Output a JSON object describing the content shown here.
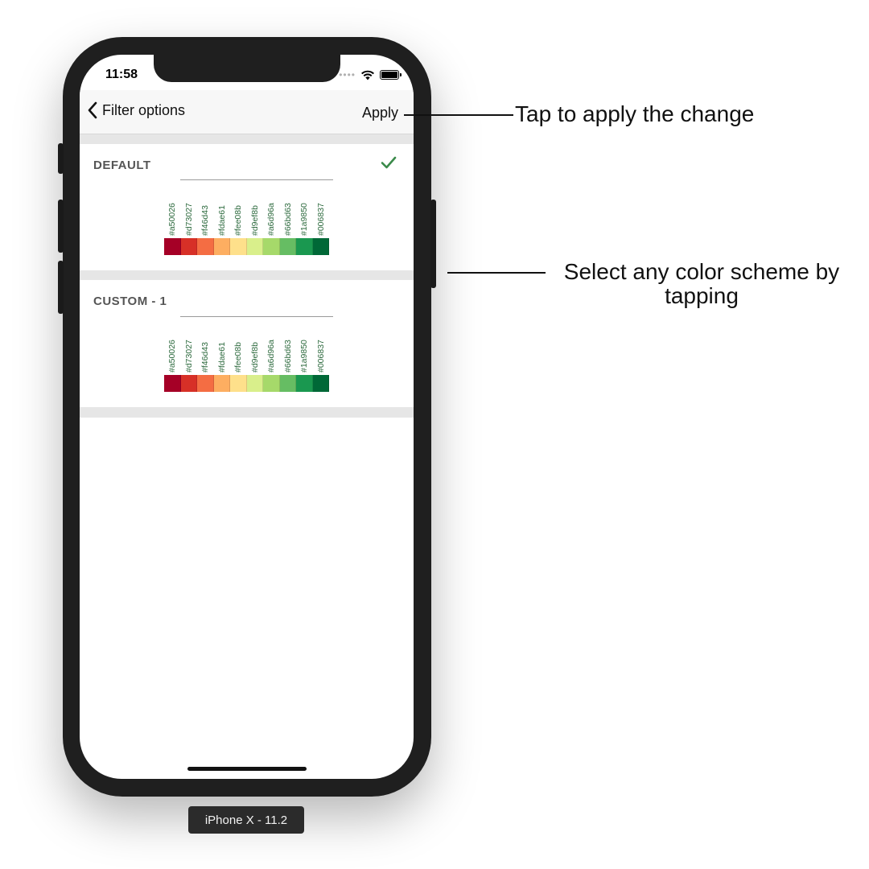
{
  "status_bar": {
    "time": "11:58",
    "signal_dots": "••••"
  },
  "navbar": {
    "back_label": "Filter options",
    "apply_label": "Apply"
  },
  "schemes": [
    {
      "title": "DEFAULT",
      "selected": true,
      "colors": [
        "#a50026",
        "#d73027",
        "#f46d43",
        "#fdae61",
        "#fee08b",
        "#d9ef8b",
        "#a6d96a",
        "#66bd63",
        "#1a9850",
        "#006837"
      ]
    },
    {
      "title": "CUSTOM - 1",
      "selected": false,
      "colors": [
        "#a50026",
        "#d73027",
        "#f46d43",
        "#fdae61",
        "#fee08b",
        "#d9ef8b",
        "#a6d96a",
        "#66bd63",
        "#1a9850",
        "#006837"
      ]
    }
  ],
  "device_label": "iPhone X - 11.2",
  "annotations": {
    "apply_hint": "Tap to apply the change",
    "select_hint_line1": "Select any color scheme by",
    "select_hint_line2": "tapping"
  },
  "colors": {
    "check": "#3a8a4a",
    "label_text": "#2d6a3e",
    "phone_frame": "#1f1f1f"
  }
}
